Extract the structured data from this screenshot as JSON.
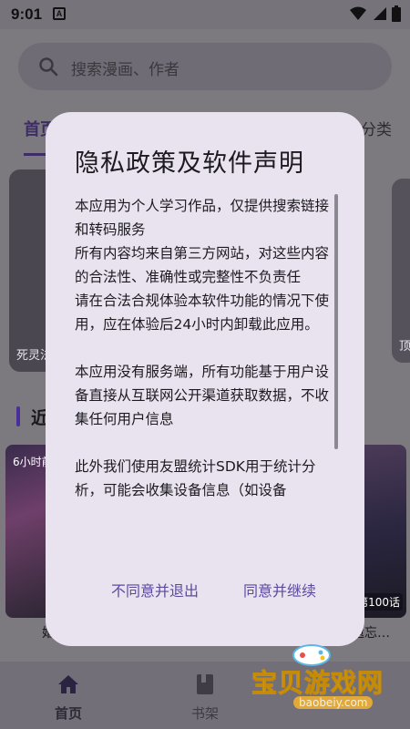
{
  "status_bar": {
    "time": "9:01",
    "notification_letter": "A"
  },
  "search": {
    "placeholder": "搜索漫画、作者"
  },
  "tabs": {
    "home": "首页",
    "category": "分类"
  },
  "carousel": {
    "left_caption": "死灵法",
    "right_caption": "顶"
  },
  "section": {
    "title": "近"
  },
  "thumbs": {
    "left_badge": "6小时前",
    "right_badge": "第100话",
    "left_caption": "婚",
    "right_caption": "遗忘…"
  },
  "dialog": {
    "title": "隐私政策及软件声明",
    "paragraphs": [
      "本应用为个人学习作品，仅提供搜索链接和转码服务",
      "所有内容均来自第三方网站，对这些内容的合法性、准确性或完整性不负责任",
      "请在合法合规体验本软件功能的情况下使用，应在体验后24小时内卸载此应用。",
      "",
      "本应用没有服务端，所有功能基于用户设备直接从互联网公开渠道获取数据，不收集任何用户信息",
      "",
      "此外我们使用友盟统计SDK用于统计分析，可能会收集设备信息（如设备"
    ],
    "decline_label": "不同意并退出",
    "accept_label": "同意并继续"
  },
  "bottom_nav": {
    "home": "首页",
    "shelf": "书架"
  },
  "watermark": {
    "text": "宝贝游戏网",
    "domain": "baobeiy.com"
  },
  "colors": {
    "dialog_bg": "#e9e3ef",
    "accent": "#5b4a9c",
    "scrim": "#7c797f"
  }
}
